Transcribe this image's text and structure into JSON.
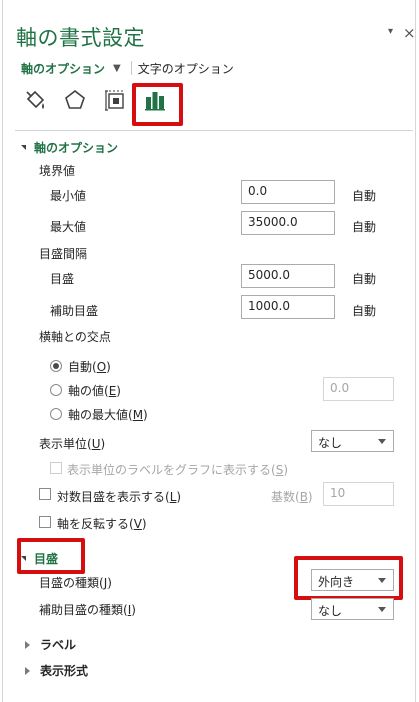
{
  "pane": {
    "title": "軸の書式設定",
    "menu_glyph": "▾",
    "close_glyph": "×"
  },
  "subtabs": {
    "active": "軸のオプション",
    "caret": "▼",
    "other": "文字のオプション"
  },
  "icons": [
    "fill-line-icon",
    "effects-pentagon-icon",
    "size-properties-icon",
    "axis-options-bar-chart-icon"
  ],
  "axis_options": {
    "header": "軸のオプション",
    "bounds": {
      "label": "境界値",
      "min": {
        "label": "最小値",
        "value": "0.0",
        "auto": "自動"
      },
      "max": {
        "label": "最大値",
        "value": "35000.0",
        "auto": "自動"
      }
    },
    "units": {
      "label": "目盛間隔",
      "major": {
        "label": "目盛",
        "value": "5000.0",
        "auto": "自動"
      },
      "minor": {
        "label": "補助目盛",
        "value": "1000.0",
        "auto": "自動"
      }
    },
    "crosses": {
      "label": "横軸との交点",
      "auto": {
        "text": "自動(",
        "key": "O",
        "end": ")",
        "selected": true
      },
      "value": {
        "text": "軸の値(",
        "key": "E",
        "end": ")",
        "selected": false,
        "input": "0.0"
      },
      "max": {
        "text": "軸の最大値(",
        "key": "M",
        "end": ")",
        "selected": false
      }
    },
    "display_units": {
      "text": "表示単位(",
      "key": "U",
      "end": ")",
      "value": "なし"
    },
    "show_units_label": {
      "text": "表示単位のラベルをグラフに表示する(",
      "key": "S",
      "end": ")",
      "checked": false
    },
    "log_scale": {
      "text": "対数目盛を表示する(",
      "key": "L",
      "end": ")",
      "checked": false,
      "base": {
        "text": "基数(",
        "key": "B",
        "end": ")",
        "value": "10"
      }
    },
    "reverse": {
      "text": "軸を反転する(",
      "key": "V",
      "end": ")",
      "checked": false
    }
  },
  "tick_marks": {
    "header": "目盛",
    "major_type": {
      "text": "目盛の種類(",
      "key": "J",
      "end": ")",
      "value": "外向き"
    },
    "minor_type": {
      "text": "補助目盛の種類(",
      "key": "I",
      "end": ")",
      "value": "なし"
    }
  },
  "collapsed_sections": {
    "labels": "ラベル",
    "number": "表示形式"
  },
  "colors": {
    "accent": "#217346",
    "highlight": "#d50f0f"
  }
}
